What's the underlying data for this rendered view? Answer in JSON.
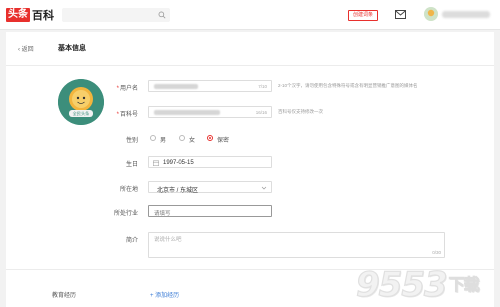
{
  "header": {
    "logo_red": "头条",
    "logo_black": "百科",
    "create_label": "创建词条"
  },
  "page": {
    "back_label": "返回",
    "title": "基本信息"
  },
  "form": {
    "username_label": "用户名",
    "username_counter": "7/10",
    "username_hint": "2-10个汉字，请勿使用包含特殊符号或含有明显营销推广意图的媒体名",
    "baike_label": "百科号",
    "baike_counter": "16/16",
    "baike_hint": "百科号仅支持修改一次",
    "gender_label": "性别",
    "gender_options": [
      "男",
      "女",
      "保密"
    ],
    "gender_selected": "保密",
    "birthday_label": "生日",
    "birthday_value": "1997-05-15",
    "location_label": "所在地",
    "location_value": "北京市 / 东城区",
    "industry_label": "所处行业",
    "industry_placeholder": "请填写",
    "bio_label": "简介",
    "bio_placeholder": "说说什么吧",
    "bio_counter": "0/30",
    "education_label": "教育经历",
    "education_add": "+ 添加经历"
  },
  "avatar_caption": "全民头条",
  "watermark": {
    "digits": "9553",
    "suffix": "下载"
  },
  "colors": {
    "brand_red": "#e8302d",
    "link_blue": "#3a7bd5"
  }
}
